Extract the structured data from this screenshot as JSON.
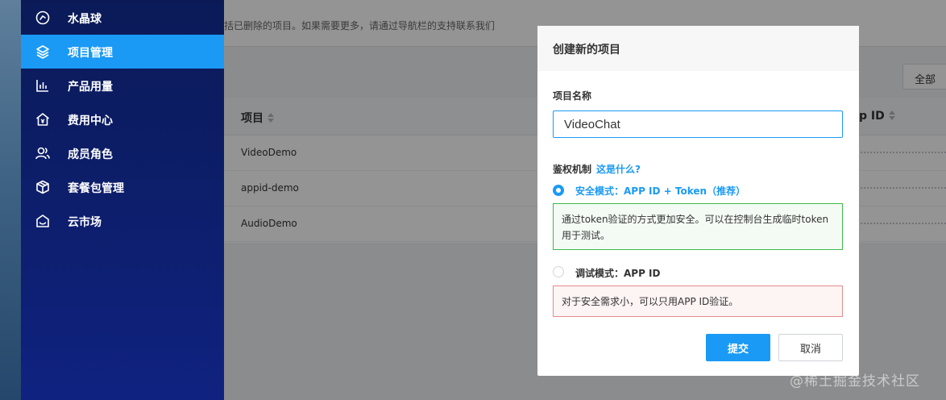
{
  "sidebar": {
    "items": [
      {
        "label": "水晶球",
        "icon": "crystal-ball-icon"
      },
      {
        "label": "项目管理",
        "icon": "layers-icon",
        "active": true
      },
      {
        "label": "产品用量",
        "icon": "bar-chart-icon"
      },
      {
        "label": "费用中心",
        "icon": "billing-house-icon"
      },
      {
        "label": "成员角色",
        "icon": "users-icon"
      },
      {
        "label": "套餐包管理",
        "icon": "package-box-icon"
      },
      {
        "label": "云市场",
        "icon": "market-icon"
      }
    ]
  },
  "page": {
    "notice": "括已删除的项目。如果需要更多，请通过导航栏的支持联系我们",
    "filter_label": "全部",
    "table": {
      "col_project": "项目",
      "col_appid": "p ID",
      "rows": [
        "VideoDemo",
        "appid-demo",
        "AudioDemo"
      ]
    }
  },
  "modal": {
    "title": "创建新的项目",
    "name_label": "项目名称",
    "name_value": "VideoChat",
    "auth_label": "鉴权机制",
    "auth_help": "这是什么?",
    "option_secure": {
      "label": "安全模式：APP ID + Token（推荐）",
      "selected": true,
      "description": "通过token验证的方式更加安全。可以在控制台生成临时token用于测试。"
    },
    "option_debug": {
      "label": "调试模式：APP ID",
      "selected": false,
      "description": "对于安全需求小，可以只用APP ID验证。"
    },
    "submit_label": "提交",
    "cancel_label": "取消"
  },
  "watermark": "@稀土掘金技术社区",
  "colors": {
    "accent": "#1a9af5",
    "sidebar_bg": "#0b1a57",
    "success_border": "#3fb94a",
    "danger_border": "#e58b8b"
  }
}
